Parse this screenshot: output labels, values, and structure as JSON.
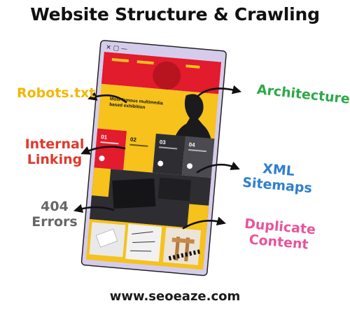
{
  "title": "Website Structure & Crawling",
  "footer": "www.seoeaze.com",
  "labels": {
    "robots": "Robots.txt",
    "internal_line1": "Internal",
    "internal_line2": "Linking",
    "errors_line1": "404",
    "errors_line2": "Errors",
    "architecture": "Architecture",
    "xml_line1": "XML",
    "xml_line2": "Sitemaps",
    "duplicate_line1": "Duplicate",
    "duplicate_line2": "Content"
  },
  "mockup": {
    "hero_heading": "Most famous multimedia based exhibition",
    "numbers": [
      "01",
      "02",
      "03",
      "04"
    ]
  },
  "colors": {
    "robots": "#f2b705",
    "internal": "#e0392b",
    "errors": "#666666",
    "architecture": "#2ea84a",
    "xml": "#2f7fd1",
    "duplicate": "#e8559a",
    "browser_frame": "#d5ccec",
    "page_yellow": "#f6c21b",
    "page_red": "#e21b2d",
    "page_dark": "#2e2e32"
  }
}
